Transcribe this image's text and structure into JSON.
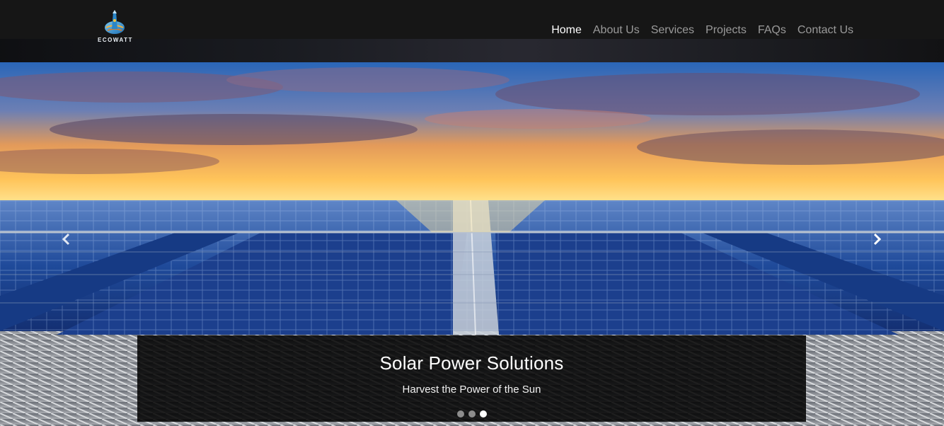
{
  "brand": {
    "name": "ECOWATT",
    "logo_icon": "globe-tower-logo"
  },
  "nav": {
    "items": [
      {
        "label": "Home",
        "active": true
      },
      {
        "label": "About Us",
        "active": false
      },
      {
        "label": "Services",
        "active": false
      },
      {
        "label": "Projects",
        "active": false
      },
      {
        "label": "FAQs",
        "active": false
      },
      {
        "label": "Contact Us",
        "active": false
      }
    ]
  },
  "carousel": {
    "caption_title": "Solar Power Solutions",
    "caption_text": "Harvest the Power of the Sun",
    "prev_icon": "chevron-left-icon",
    "next_icon": "chevron-right-icon",
    "slide_count": 3,
    "active_slide": 3
  },
  "colors": {
    "navbar_bg": "#161616",
    "active_link": "#ffffff",
    "inactive_link": "#9a9a9a"
  }
}
